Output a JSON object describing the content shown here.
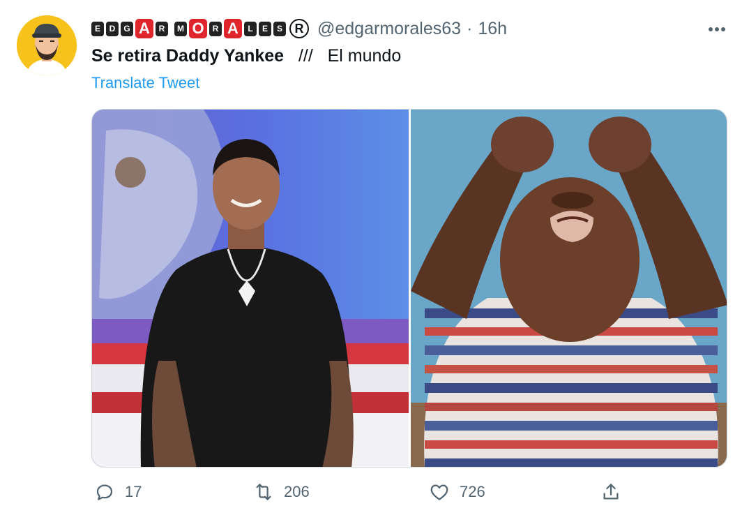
{
  "tweet": {
    "author_badges": [
      "E",
      "D",
      "G",
      "A",
      "R",
      "M",
      "O",
      "R",
      "A",
      "L",
      "E",
      "S"
    ],
    "author_badge_big_indices": [
      3,
      6,
      8
    ],
    "registered_mark": "R",
    "handle": "@edgarmorales63",
    "separator": "·",
    "time": "16h",
    "text_bold": "Se retira Daddy Yankee",
    "text_rest": "   ///   El mundo",
    "translate_label": "Translate Tweet",
    "reply_count": "17",
    "retweet_count": "206",
    "like_count": "726"
  },
  "icons": {
    "more": "more-horizontal-icon",
    "reply": "reply-icon",
    "retweet": "retweet-icon",
    "like": "heart-icon",
    "share": "share-icon"
  },
  "colors": {
    "link": "#1d9bf0",
    "muted": "#536471",
    "badge_red": "#e0262d"
  }
}
